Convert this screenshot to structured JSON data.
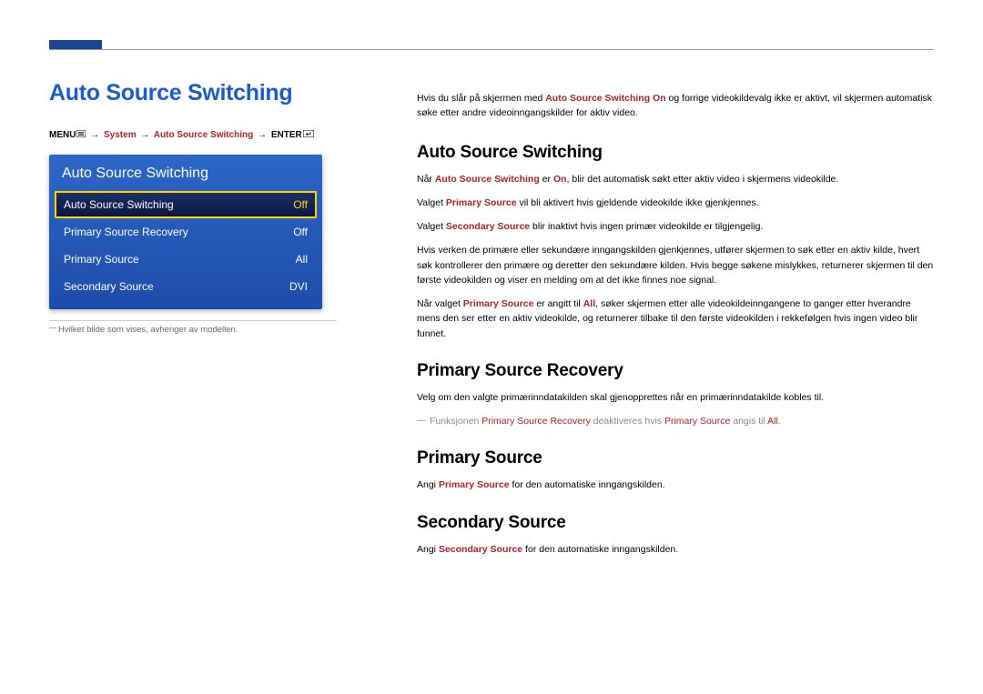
{
  "page": {
    "main_title": "Auto Source Switching",
    "footnote": "Hvilket bilde som vises, avhenger av modellen."
  },
  "breadcrumb": {
    "menu": "MENU",
    "system": "System",
    "ass": "Auto Source Switching",
    "enter": "ENTER",
    "arrow": "→"
  },
  "osd": {
    "title": "Auto Source Switching",
    "rows": [
      {
        "label": "Auto Source Switching",
        "value": "Off"
      },
      {
        "label": "Primary Source Recovery",
        "value": "Off"
      },
      {
        "label": "Primary Source",
        "value": "All"
      },
      {
        "label": "Secondary Source",
        "value": "DVI"
      }
    ]
  },
  "intro": {
    "pre": "Hvis du slår på skjermen med ",
    "hl": "Auto Source Switching On",
    "post": " og forrige videokildevalg ikke er aktivt, vil skjermen automatisk søke etter andre videoinngangskilder for aktiv video."
  },
  "sections": {
    "ass": {
      "heading": "Auto Source Switching",
      "p1_pre": "Når ",
      "p1_hl1": "Auto Source Switching",
      "p1_mid": " er ",
      "p1_hl2": "On",
      "p1_post": ", blir det automatisk søkt etter aktiv video i skjermens videokilde.",
      "p2_pre": "Valget ",
      "p2_hl": "Primary Source",
      "p2_post": " vil bli aktivert hvis gjeldende videokilde ikke gjenkjennes.",
      "p3_pre": "Valget ",
      "p3_hl": "Secondary Source",
      "p3_post": " blir inaktivt hvis ingen primær videokilde er tilgjengelig.",
      "p4": "Hvis verken de primære eller sekundære inngangskilden gjenkjennes, utfører skjermen to søk etter en aktiv kilde, hvert søk kontrollerer den primære og deretter den sekundære kilden. Hvis begge søkene mislykkes, returnerer skjermen til den første videokilden og viser en melding om at det ikke finnes noe signal.",
      "p5_pre": "Når valget ",
      "p5_hl1": "Primary Source",
      "p5_mid": " er angitt til ",
      "p5_hl2": "All",
      "p5_post": ", søker skjermen etter alle videokildeinngangene to ganger etter hverandre mens den ser etter en aktiv videokilde, og returnerer tilbake til den første videokilden i rekkefølgen hvis ingen video blir funnet."
    },
    "psr": {
      "heading": "Primary Source Recovery",
      "p1": "Velg om den valgte primærinndatakilden skal gjenopprettes når en primærinndatakilde kobles til.",
      "note_pre": "Funksjonen ",
      "note_hl1": "Primary Source Recovery",
      "note_mid": " deaktiveres hvis ",
      "note_hl2": "Primary Source",
      "note_mid2": " angis til ",
      "note_hl3": "All",
      "note_post": "."
    },
    "ps": {
      "heading": "Primary Source",
      "p1_pre": "Angi ",
      "p1_hl": "Primary Source",
      "p1_post": " for den automatiske inngangskilden."
    },
    "ss": {
      "heading": "Secondary Source",
      "p1_pre": "Angi ",
      "p1_hl": "Secondary Source",
      "p1_post": " for den automatiske inngangskilden."
    }
  }
}
